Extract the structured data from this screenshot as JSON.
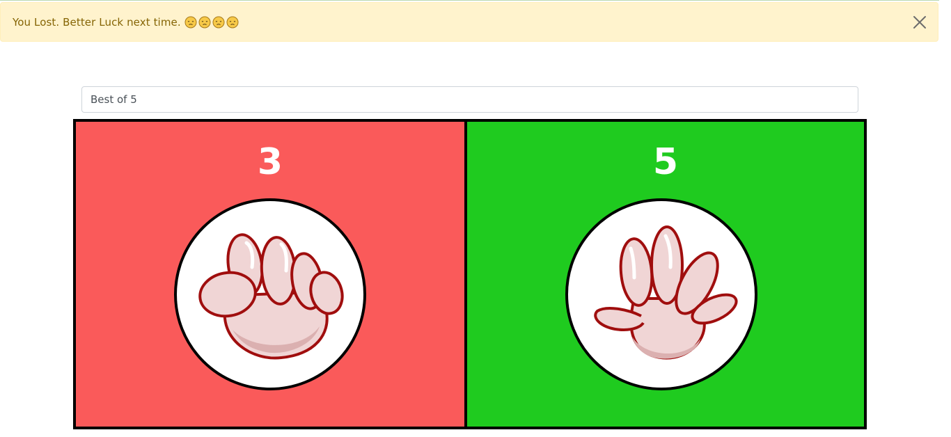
{
  "alert": {
    "message": "You Lost. Better Luck next time.",
    "emoji_count": 4,
    "emoji_icon": "sad-face-emoji",
    "background": "#fff3cd",
    "text_color": "#856404"
  },
  "select": {
    "selected": "Best of 5"
  },
  "board": {
    "player": {
      "score": "3",
      "hand": "rock-fist-icon",
      "color": "#fa5a5a"
    },
    "opponent": {
      "score": "5",
      "hand": "paper-hand-icon",
      "color": "#1fcb1f"
    }
  }
}
